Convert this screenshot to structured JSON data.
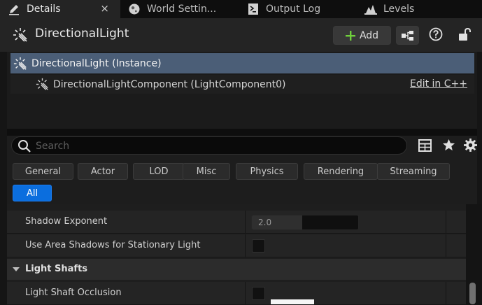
{
  "tabs": [
    {
      "label": "Details",
      "icon": "pencil-icon",
      "active": true,
      "close": "×"
    },
    {
      "label": "World Settin...",
      "icon": "globe-icon"
    },
    {
      "label": "Output Log",
      "icon": "terminal-icon"
    },
    {
      "label": "Levels",
      "icon": "levels-icon"
    }
  ],
  "header": {
    "title": "DirectionalLight",
    "add_label": "Add"
  },
  "tree": {
    "instance_label": "DirectionalLight (Instance)",
    "component_label": "DirectionalLightComponent (LightComponent0)",
    "edit_link": "Edit in C++"
  },
  "search": {
    "placeholder": "Search",
    "value": ""
  },
  "filters": [
    "General",
    "Actor",
    "LOD",
    "Misc",
    "Physics",
    "Rendering",
    "Streaming",
    "All"
  ],
  "active_filter": "All",
  "properties": {
    "shadow_exponent": {
      "label": "Shadow Exponent",
      "value": "2.0"
    },
    "use_area_shadows": {
      "label": "Use Area Shadows for Stationary Light",
      "checked": false
    },
    "light_shafts_category": "Light Shafts",
    "light_shaft_occlusion": {
      "label": "Light Shaft Occlusion",
      "checked": false
    }
  },
  "colors": {
    "accent": "#0b6ede",
    "selected_row": "#4b5e77",
    "add_plus": "#6fcf3c"
  }
}
